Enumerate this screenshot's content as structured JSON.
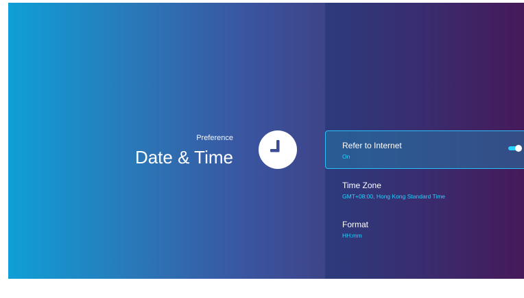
{
  "header": {
    "subtitle": "Preference",
    "title": "Date & Time",
    "icon": "clock-icon"
  },
  "settings": {
    "items": [
      {
        "label": "Refer to Internet",
        "value": "On",
        "toggle": true,
        "selected": true
      },
      {
        "label": "Time Zone",
        "value": "GMT+08:00, Hong Kong Standard Time"
      },
      {
        "label": "Format",
        "value": "HH:mm"
      }
    ]
  },
  "colors": {
    "accent": "#2ad0ff",
    "left_gradient_start": "#0f9fd6",
    "right_gradient_end": "#461a5a"
  }
}
